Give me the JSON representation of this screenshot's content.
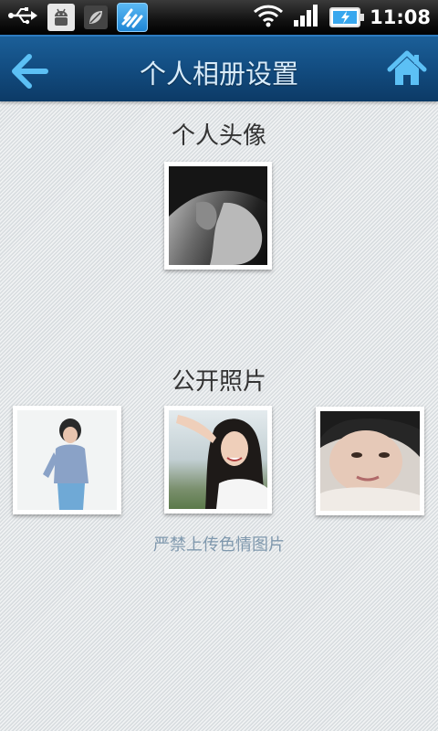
{
  "status_bar": {
    "time": "11:08",
    "icons": [
      "usb-icon",
      "android-debug-icon",
      "leaf-app-icon",
      "app-shortcut-icon",
      "wifi-icon",
      "signal-icon",
      "battery-charging-icon"
    ]
  },
  "header": {
    "title": "个人相册设置",
    "back_icon": "back-arrow-icon",
    "home_icon": "home-icon"
  },
  "avatar_section": {
    "title": "个人头像"
  },
  "public_section": {
    "title": "公开照片",
    "photos": [
      "photo-1",
      "photo-2",
      "photo-3"
    ],
    "notice": "严禁上传色情图片"
  },
  "colors": {
    "header_blue": "#134e83",
    "title_text": "#d8ecfb",
    "accent_icon": "#4fb6f2",
    "notice_text": "#7f98ad"
  }
}
